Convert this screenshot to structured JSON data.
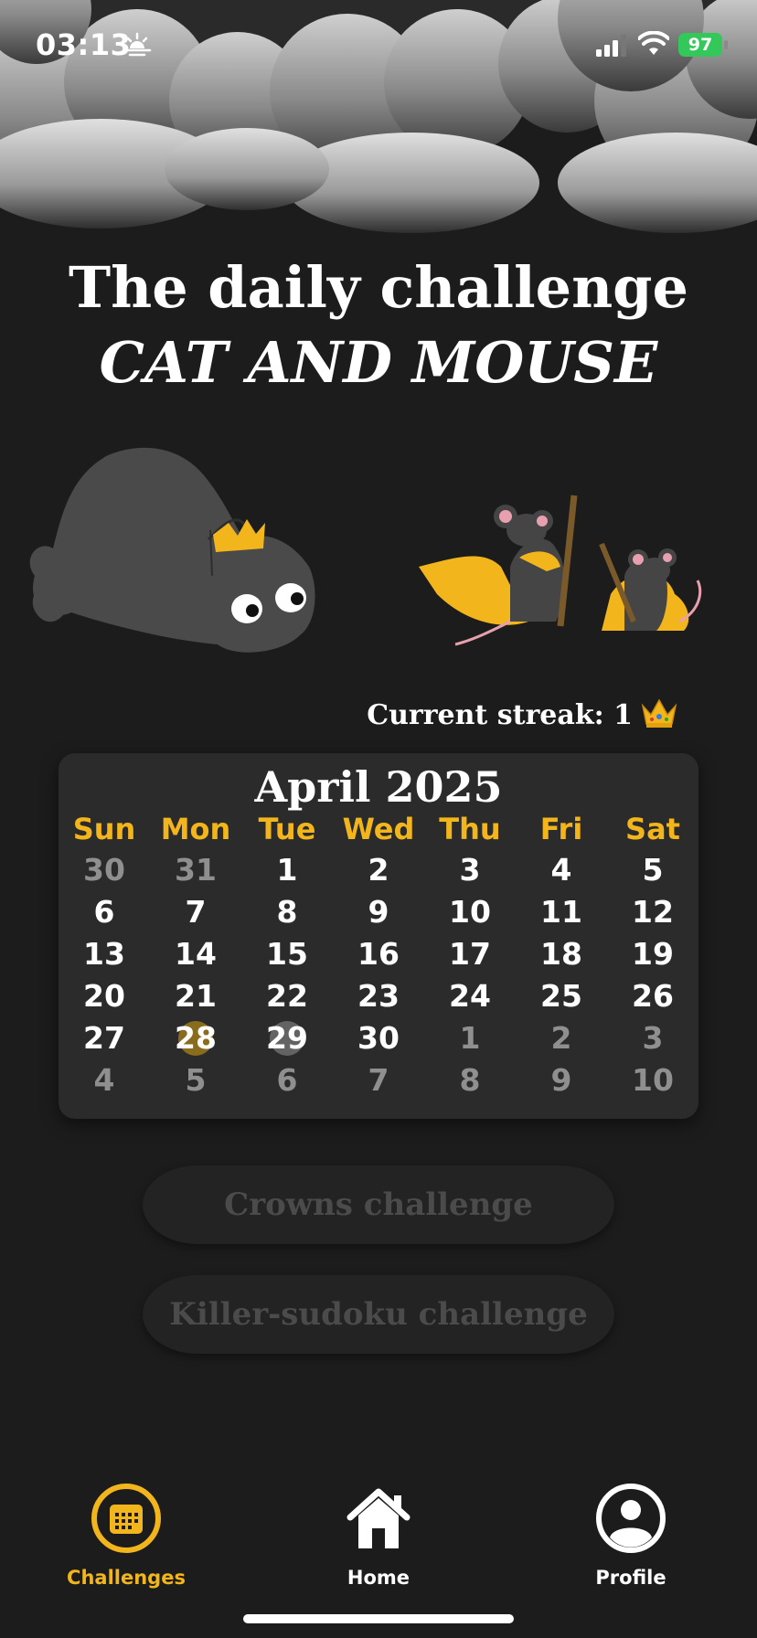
{
  "status_bar": {
    "time": "03:13",
    "battery": "97"
  },
  "header": {
    "line1": "The daily challenge",
    "line2": "CAT AND MOUSE"
  },
  "streak": {
    "label": "Current streak: 1"
  },
  "calendar": {
    "month": "April 2025",
    "weekdays": [
      "Sun",
      "Mon",
      "Tue",
      "Wed",
      "Thu",
      "Fri",
      "Sat"
    ],
    "weeks": [
      [
        "30",
        "31",
        "1",
        "2",
        "3",
        "4",
        "5"
      ],
      [
        "6",
        "7",
        "8",
        "9",
        "10",
        "11",
        "12"
      ],
      [
        "13",
        "14",
        "15",
        "16",
        "17",
        "18",
        "19"
      ],
      [
        "20",
        "21",
        "22",
        "23",
        "24",
        "25",
        "26"
      ],
      [
        "27",
        "28",
        "29",
        "30",
        "1",
        "2",
        "3"
      ],
      [
        "4",
        "5",
        "6",
        "7",
        "8",
        "9",
        "10"
      ]
    ],
    "completed_day": "28",
    "today": "29"
  },
  "challenges": {
    "crowns": "Crowns challenge",
    "killer_sudoku": "Killer-sudoku challenge"
  },
  "tabs": {
    "challenges": "Challenges",
    "home": "Home",
    "profile": "Profile"
  },
  "colors": {
    "accent": "#f2b51c",
    "background": "#1c1c1c",
    "card": "#2b2b2b",
    "battery": "#34c759"
  }
}
